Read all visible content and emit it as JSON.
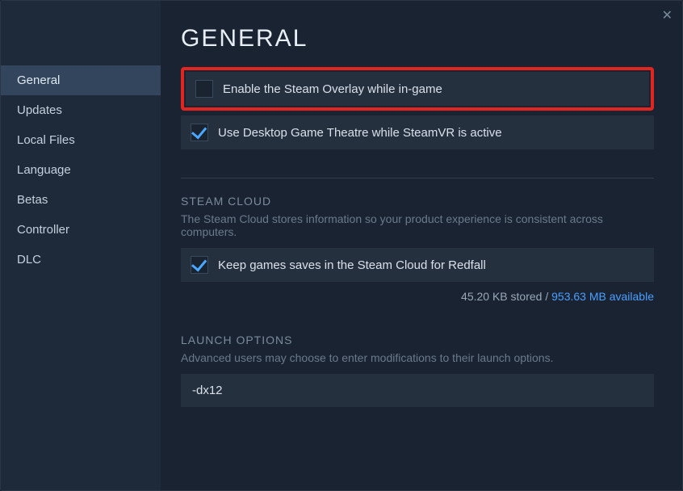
{
  "page_title": "GENERAL",
  "sidebar": {
    "items": [
      {
        "label": "General",
        "active": true
      },
      {
        "label": "Updates",
        "active": false
      },
      {
        "label": "Local Files",
        "active": false
      },
      {
        "label": "Language",
        "active": false
      },
      {
        "label": "Betas",
        "active": false
      },
      {
        "label": "Controller",
        "active": false
      },
      {
        "label": "DLC",
        "active": false
      }
    ]
  },
  "options": {
    "overlay": {
      "label": "Enable the Steam Overlay while in-game",
      "checked": false
    },
    "theatre": {
      "label": "Use Desktop Game Theatre while SteamVR is active",
      "checked": true
    }
  },
  "cloud": {
    "title": "STEAM CLOUD",
    "desc": "The Steam Cloud stores information so your product experience is consistent across computers.",
    "option": {
      "label": "Keep games saves in the Steam Cloud for Redfall",
      "checked": true
    },
    "stored_text": "45.20 KB stored / ",
    "available_text": "953.63 MB available"
  },
  "launch": {
    "title": "LAUNCH OPTIONS",
    "desc": "Advanced users may choose to enter modifications to their launch options.",
    "value": "-dx12"
  }
}
